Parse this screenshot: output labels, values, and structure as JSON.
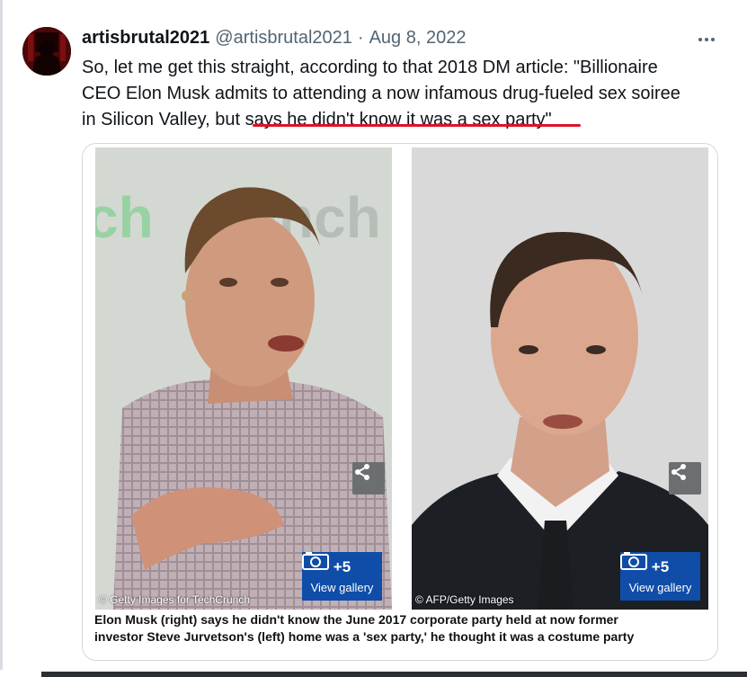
{
  "tweet": {
    "display_name": "artisbrutal2021",
    "handle": "@artisbrutal2021",
    "separator": "·",
    "date": "Aug 8, 2022",
    "more_icon": "ellipsis-icon",
    "text_lines": [
      "So, let me get this straight, according to that 2018 DM article: \"Billionaire",
      "CEO Elon Musk admits to attending a now infamous drug-fueled sex soiree"
    ],
    "text_line3_prefix": "in Silicon Valley, but ",
    "text_line3_underlined": "says he didn't know it was a sex party\"",
    "underline_color": "#e0112a"
  },
  "card": {
    "left_photo": {
      "credit": "© Getty Images for TechCrunch",
      "gallery_count": "+5",
      "gallery_label": "View gallery"
    },
    "right_photo": {
      "credit": "© AFP/Getty Images",
      "gallery_count": "+5",
      "gallery_label": "View gallery"
    },
    "caption_lines": [
      "Elon Musk (right) says he didn't know the June 2017 corporate party held at now former",
      "investor Steve Jurvetson's (left) home was a 'sex party,' he thought it was a costume party"
    ]
  },
  "colors": {
    "name": "#0f1419",
    "secondary": "#536471",
    "gallery_button": "#0f4da8",
    "border": "#cfd9de"
  }
}
